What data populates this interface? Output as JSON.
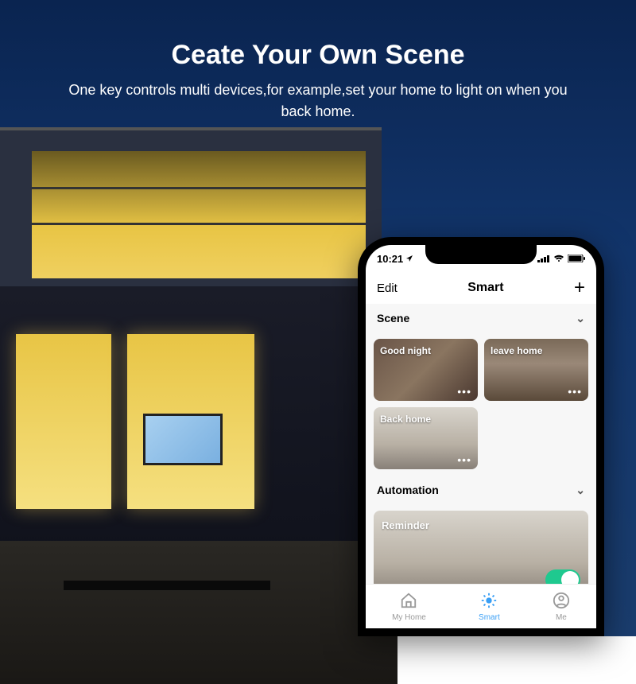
{
  "hero": {
    "title": "Ceate Your Own Scene",
    "subtitle": "One key controls multi devices,for example,set your home to light on when you back home."
  },
  "status": {
    "time": "10:21",
    "location_arrow": "↗"
  },
  "header": {
    "edit": "Edit",
    "title": "Smart",
    "plus": "+"
  },
  "sections": {
    "scene": "Scene",
    "automation": "Automation"
  },
  "scenes": [
    {
      "label": "Good night"
    },
    {
      "label": "leave home"
    },
    {
      "label": "Back home"
    }
  ],
  "automation": {
    "label": "Reminder",
    "toggle_on": true
  },
  "tabs": [
    {
      "label": "My Home"
    },
    {
      "label": "Smart"
    },
    {
      "label": "Me"
    }
  ]
}
